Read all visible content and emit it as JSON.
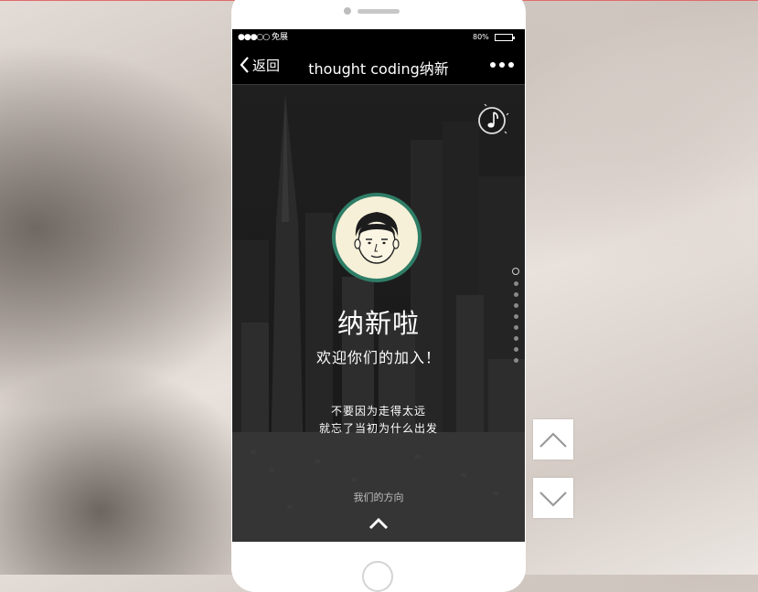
{
  "status_bar": {
    "signal": "●●●○○",
    "carrier": "免展",
    "battery_percent": "80%",
    "battery_level": 0.8
  },
  "nav_bar": {
    "back_label": "返回",
    "title": "thought coding纳新"
  },
  "page": {
    "headline": "纳新啦",
    "subline": "欢迎你们的加入！",
    "quote_line1": "不要因为走得太远",
    "quote_line2": "就忘了当初为什么出发",
    "footer_hint": "我们的方向"
  },
  "page_indicator": {
    "total": 9,
    "current": 1
  },
  "icons": {
    "back": "chevron-left-icon",
    "more": "more-dots-icon",
    "music": "music-note-icon",
    "up": "chevron-up-icon",
    "down": "chevron-down-icon"
  },
  "colors": {
    "avatar_ring": "#2f7d66",
    "avatar_bg": "#f6f0d8",
    "bar_bg": "#000000",
    "top_line": "#e26b6b"
  }
}
